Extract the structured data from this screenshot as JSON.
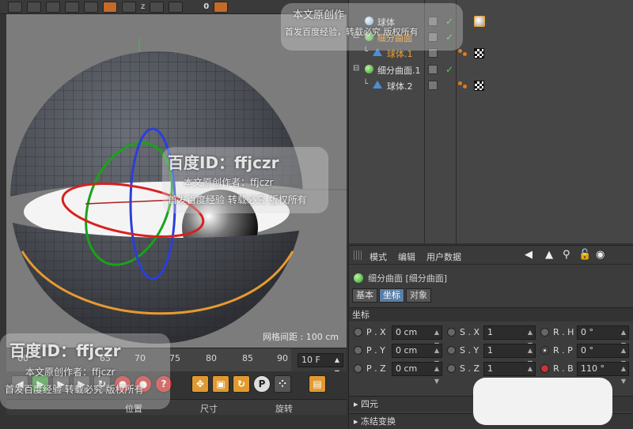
{
  "toolbar": {
    "frame_counter": "0",
    "axis_label": "z"
  },
  "viewport": {
    "grid_spacing": "网格间距 : 100 cm"
  },
  "timeline": {
    "ticks": [
      "60",
      "65",
      "70",
      "75",
      "80",
      "85",
      "90"
    ],
    "frame_end": "10 F"
  },
  "transport": {
    "p_label": "P",
    "help_label": "?"
  },
  "coords_bar": {
    "position": "位置",
    "size": "尺寸",
    "rotation": "旋转"
  },
  "object_manager": {
    "objects": [
      {
        "name": "球体",
        "level": 0
      },
      {
        "name": "细分曲面",
        "level": 0
      },
      {
        "name": "球体.1",
        "level": 1
      },
      {
        "name": "细分曲面.1",
        "level": 0
      },
      {
        "name": "球体.2",
        "level": 1
      }
    ],
    "tree_marks": {
      "expanded": "⊟",
      "branch": "└"
    }
  },
  "attribute_manager": {
    "menu": {
      "mode": "模式",
      "edit": "编辑",
      "user_data": "用户数据"
    },
    "object_title": "细分曲面 [细分曲面]",
    "tabs": [
      "基本",
      "坐标",
      "对象"
    ],
    "section": "坐标",
    "coords": {
      "px_label": "P . X",
      "px": "0 cm",
      "py_label": "P . Y",
      "py": "0 cm",
      "pz_label": "P . Z",
      "pz": "0 cm",
      "sx_label": "S . X",
      "sx": "1",
      "sy_label": "S . Y",
      "sy": "1",
      "sz_label": "S . Z",
      "sz": "1",
      "rh_label": "R . H",
      "rh": "0 °",
      "rp_label": "R . P",
      "rp": "0 °",
      "rb_label": "R . B",
      "rb": "110 °"
    },
    "collapsed": [
      "四元",
      "冻结变换"
    ]
  },
  "watermarks": {
    "baidu_id": "百度ID：ffjczr",
    "original": "本文原创作者：ffjczr",
    "experience": "首发百度经验 转载必究 版权所有",
    "short_original": "本文原创作",
    "short_experience": "首发百度经验，转载必究 版权所有"
  },
  "colors": {
    "accent_orange": "#f0a030",
    "active_tab": "#5a7ea8",
    "check_green": "#4bd04b"
  }
}
